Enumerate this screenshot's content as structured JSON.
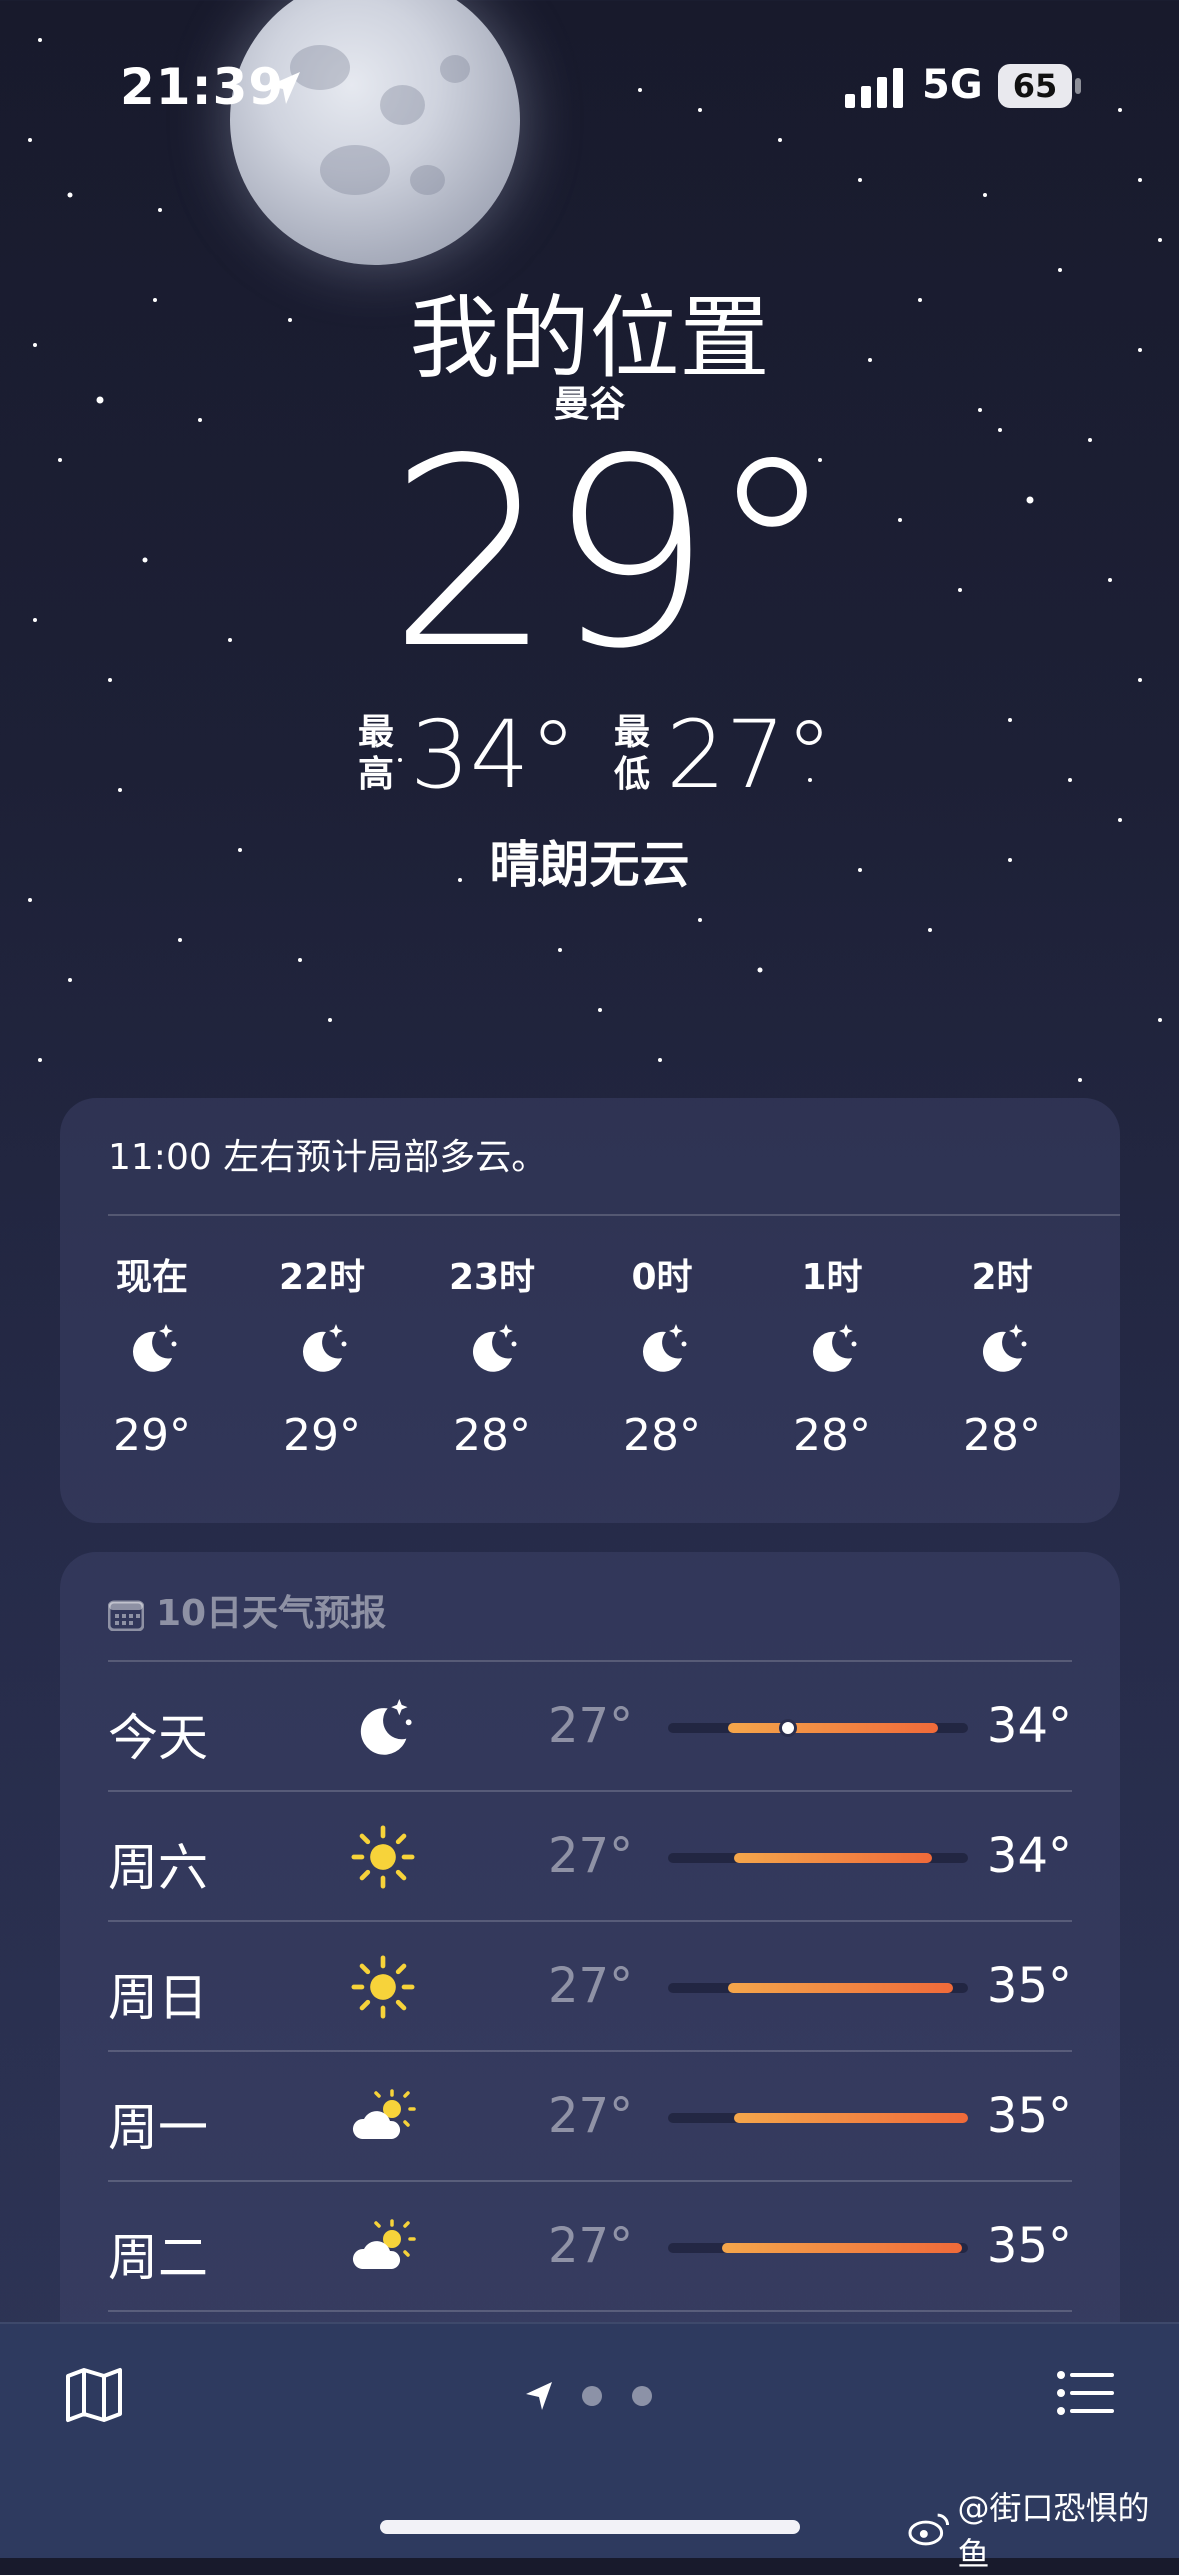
{
  "status": {
    "time": "21:39",
    "network": "5G",
    "battery": "65"
  },
  "header": {
    "location": "我的位置",
    "city": "曼谷",
    "temperature": "29°",
    "high_label": "最高",
    "high": "34°",
    "low_label": "最低",
    "low": "27°",
    "condition": "晴朗无云"
  },
  "hourly": {
    "summary": "11:00 左右预计局部多云。",
    "items": [
      {
        "label": "现在",
        "icon": "moon-stars-icon",
        "temp": "29°"
      },
      {
        "label": "22时",
        "icon": "moon-stars-icon",
        "temp": "29°"
      },
      {
        "label": "23时",
        "icon": "moon-stars-icon",
        "temp": "28°"
      },
      {
        "label": "0时",
        "icon": "moon-stars-icon",
        "temp": "28°"
      },
      {
        "label": "1时",
        "icon": "moon-stars-icon",
        "temp": "28°"
      },
      {
        "label": "2时",
        "icon": "moon-stars-icon",
        "temp": "28°"
      }
    ]
  },
  "forecast": {
    "title": "10日天气预报",
    "days": [
      {
        "day": "今天",
        "icon": "moon-stars-icon",
        "low": "27°",
        "high": "34°",
        "range_start": 0.2,
        "range_end": 0.9,
        "current": 0.4
      },
      {
        "day": "周六",
        "icon": "sun-icon",
        "low": "27°",
        "high": "34°",
        "range_start": 0.22,
        "range_end": 0.88
      },
      {
        "day": "周日",
        "icon": "sun-icon",
        "low": "27°",
        "high": "35°",
        "range_start": 0.2,
        "range_end": 0.95
      },
      {
        "day": "周一",
        "icon": "partly-cloudy-icon",
        "low": "27°",
        "high": "35°",
        "range_start": 0.22,
        "range_end": 1.0
      },
      {
        "day": "周二",
        "icon": "partly-cloudy-icon",
        "low": "27°",
        "high": "35°",
        "range_start": 0.18,
        "range_end": 0.98
      }
    ]
  },
  "watermark": "@街口恐惧的鱼",
  "colors": {
    "bar_start": "#f4a64b",
    "bar_end": "#f06a3a",
    "sun": "#f7d33a"
  }
}
